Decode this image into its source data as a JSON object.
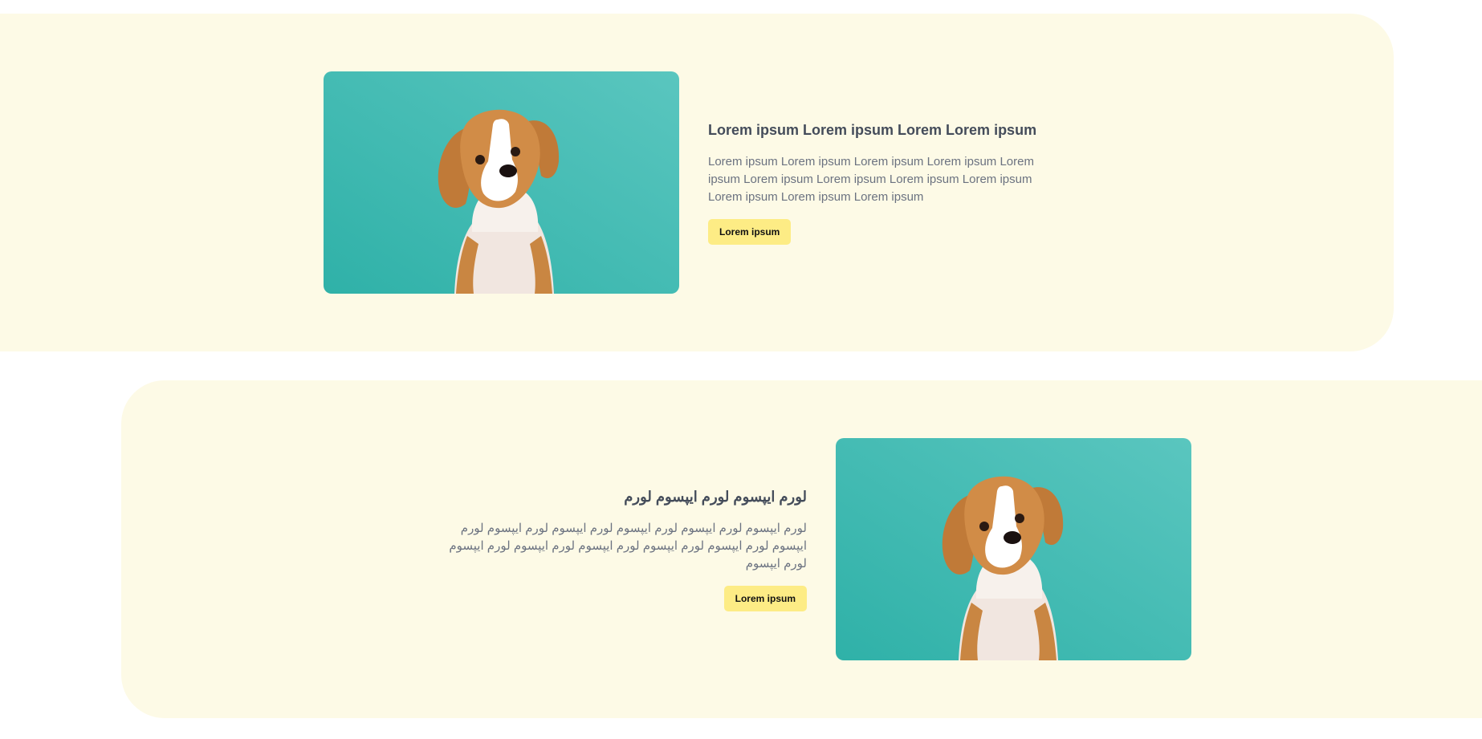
{
  "sections": [
    {
      "title": "Lorem ipsum Lorem ipsum Lorem Lorem ipsum",
      "body": "Lorem ipsum Lorem ipsum Lorem ipsum Lorem ipsum Lorem ipsum Lorem ipsum Lorem ipsum Lorem ipsum Lorem ipsum Lorem ipsum Lorem ipsum Lorem ipsum",
      "button_label": "Lorem ipsum",
      "image": "puppy-photo"
    },
    {
      "title": "لورم ایپسوم لورم ایپسوم لورم",
      "body": "لورم ایپسوم لورم ایپسوم لورم ایپسوم لورم ایپسوم لورم ایپسوم لورم ایپسوم لورم ایپسوم لورم ایپسوم لورم ایپسوم لورم ایپسوم لورم ایپسوم لورم ایپسوم",
      "button_label": "Lorem ipsum",
      "image": "puppy-photo"
    }
  ],
  "colors": {
    "band": "#fdfae6",
    "button": "#fdec85",
    "photo_background": "#3dbab2"
  }
}
